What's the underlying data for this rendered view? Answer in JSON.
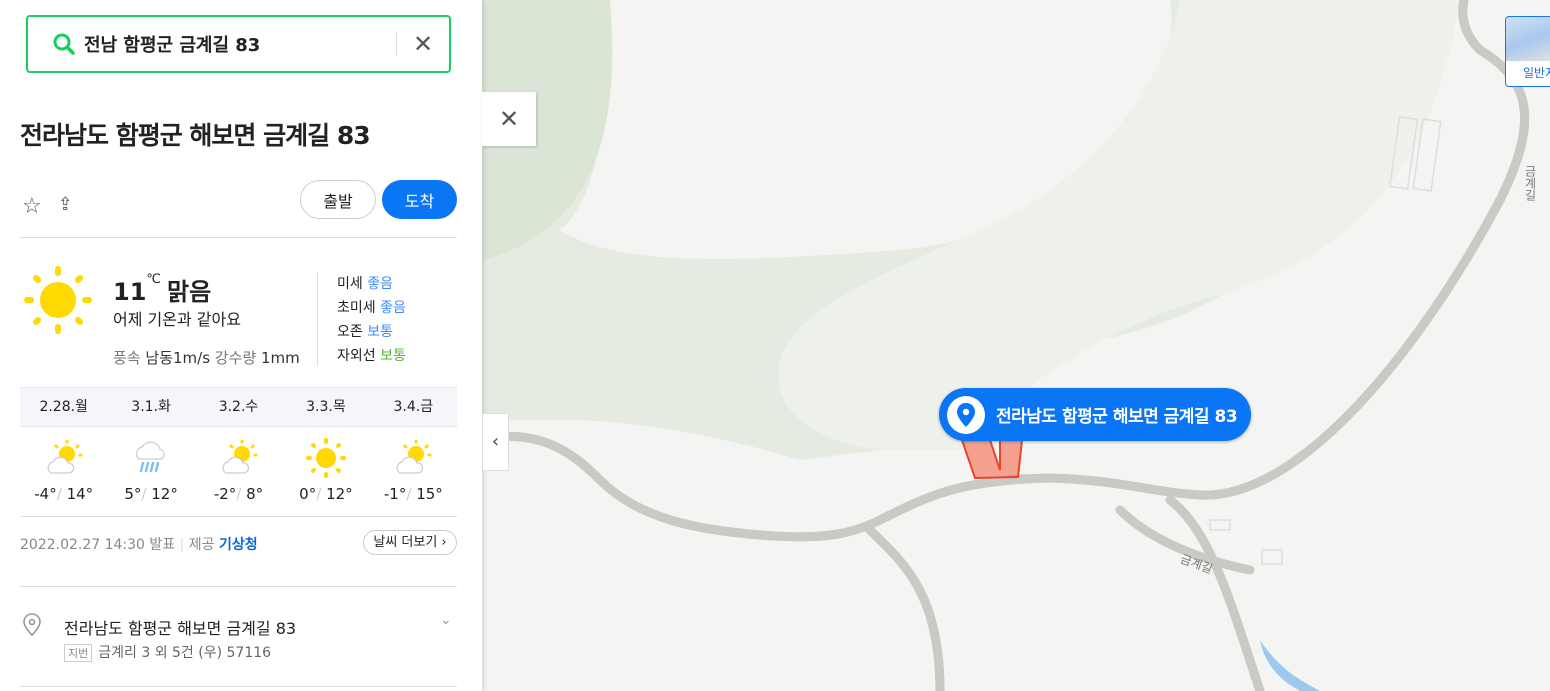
{
  "search": {
    "query": "전남 함평군 금계길 83",
    "icon": "search-icon",
    "clear_icon": "close-icon"
  },
  "place": {
    "title": "전라남도 함평군 해보면 금계길 83",
    "depart_label": "출발",
    "arrive_label": "도착",
    "favorite_icon": "star-icon",
    "share_icon": "share-icon"
  },
  "weather": {
    "temp": "11",
    "unit": "℃",
    "condition": "맑음",
    "compare": "어제 기온과 같아요",
    "wind_label": "풍속",
    "wind_value": "남동1m/s",
    "rain_label": "강수량",
    "rain_value": "1mm",
    "air": [
      {
        "label": "미세",
        "value": "좋음"
      },
      {
        "label": "초미세",
        "value": "좋음"
      },
      {
        "label": "오존",
        "value": "보통"
      },
      {
        "label": "자외선",
        "value": "보통"
      }
    ],
    "forecast": [
      {
        "day": "2.28.월",
        "icon": "partly-cloudy",
        "low": "-4°",
        "high": "14°"
      },
      {
        "day": "3.1.화",
        "icon": "rain",
        "low": "5°",
        "high": "12°"
      },
      {
        "day": "3.2.수",
        "icon": "partly-cloudy",
        "low": "-2°",
        "high": "8°"
      },
      {
        "day": "3.3.목",
        "icon": "sunny",
        "low": "0°",
        "high": "12°"
      },
      {
        "day": "3.4.금",
        "icon": "partly-cloudy",
        "low": "-1°",
        "high": "15°"
      }
    ],
    "issued": "2022.02.27 14:30 발표",
    "provider_label": "제공",
    "provider": "기상청",
    "more_label": "날씨 더보기"
  },
  "address": {
    "road": "전라남도 함평군 해보면 금계길 83",
    "jibun_tag": "지번",
    "jibun": "금계리 3 외 5건 (우) 57116"
  },
  "map": {
    "marker_label": "전라남도 함평군 해보면 금계길 83",
    "road_labels": [
      "금계길",
      "금계길"
    ],
    "map_type_label": "일반지도",
    "highlight_color": "#f4694f",
    "accent": "#0a75f5"
  }
}
